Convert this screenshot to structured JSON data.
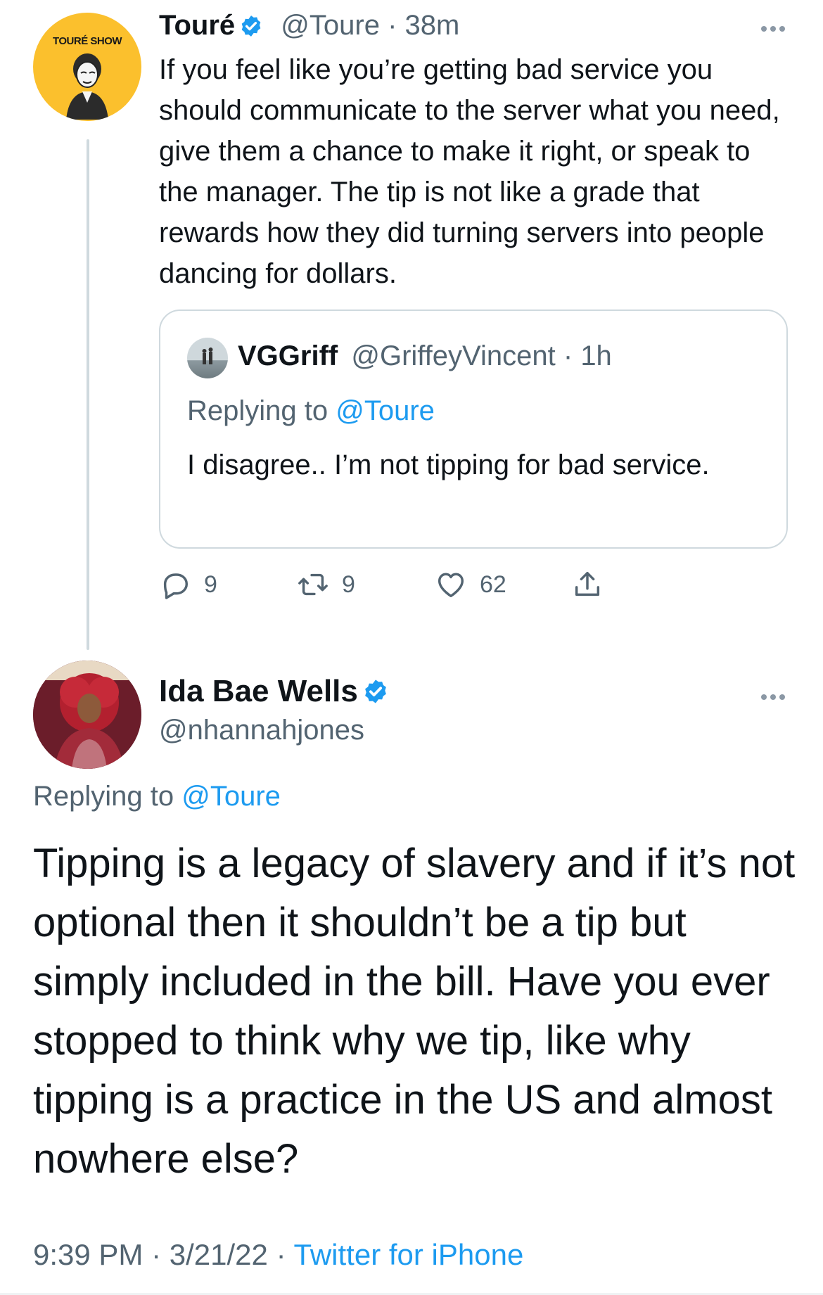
{
  "colors": {
    "accent": "#1d9bf0",
    "muted": "#536471",
    "text": "#0f1419",
    "border": "#cfd9de"
  },
  "toure_tweet": {
    "avatar_label": "TOURÉ SHOW",
    "display_name": "Touré",
    "handle": "@Toure",
    "separator": "·",
    "time": "38m",
    "text": "If you feel like you’re getting bad service you should communicate to the server what you need, give them a chance to make it right, or speak to the manager. The tip is not like a grade that rewards how they did turning servers into people dancing for dollars.",
    "quoted_tweet": {
      "display_name": "VGGriff",
      "handle": "@GriffeyVincent",
      "separator": "·",
      "time": "1h",
      "replying_prefix": "Replying to",
      "replying_handle": "@Toure",
      "text": "I disagree.. I’m not tipping for bad service."
    },
    "actions": {
      "reply_icon": "reply-icon",
      "reply_count": "9",
      "retweet_icon": "retweet-icon",
      "retweet_count": "9",
      "like_icon": "heart-icon",
      "like_count": "62",
      "share_icon": "share-icon"
    }
  },
  "ida_tweet": {
    "display_name": "Ida Bae Wells",
    "handle": "@nhannahjones",
    "replying_prefix": "Replying to",
    "replying_handle": "@Toure",
    "text": "Tipping is a legacy of slavery and if it’s not optional then it shouldn’t be a tip but simply included in the bill. Have you ever stopped to think why we tip, like why tipping is a practice in the US and almost nowhere else?",
    "time": "9:39 PM",
    "separator1": "·",
    "date": "3/21/22",
    "separator2": "·",
    "source": "Twitter for iPhone"
  }
}
